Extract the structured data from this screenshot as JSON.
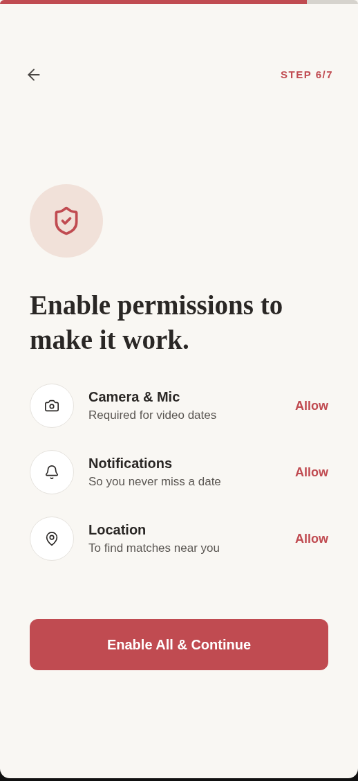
{
  "progress": {
    "level": 0.857
  },
  "header": {
    "step": "STEP 6/7"
  },
  "title": "Enable permissions to make it work.",
  "permissions": [
    {
      "title": "Camera & Mic",
      "subtitle": "Required for video dates",
      "action": "Allow"
    },
    {
      "title": "Notifications",
      "subtitle": "So you never miss a date",
      "action": "Allow"
    },
    {
      "title": "Location",
      "subtitle": "To find matches near you",
      "action": "Allow"
    }
  ],
  "primary_button": "Enable All & Continue"
}
